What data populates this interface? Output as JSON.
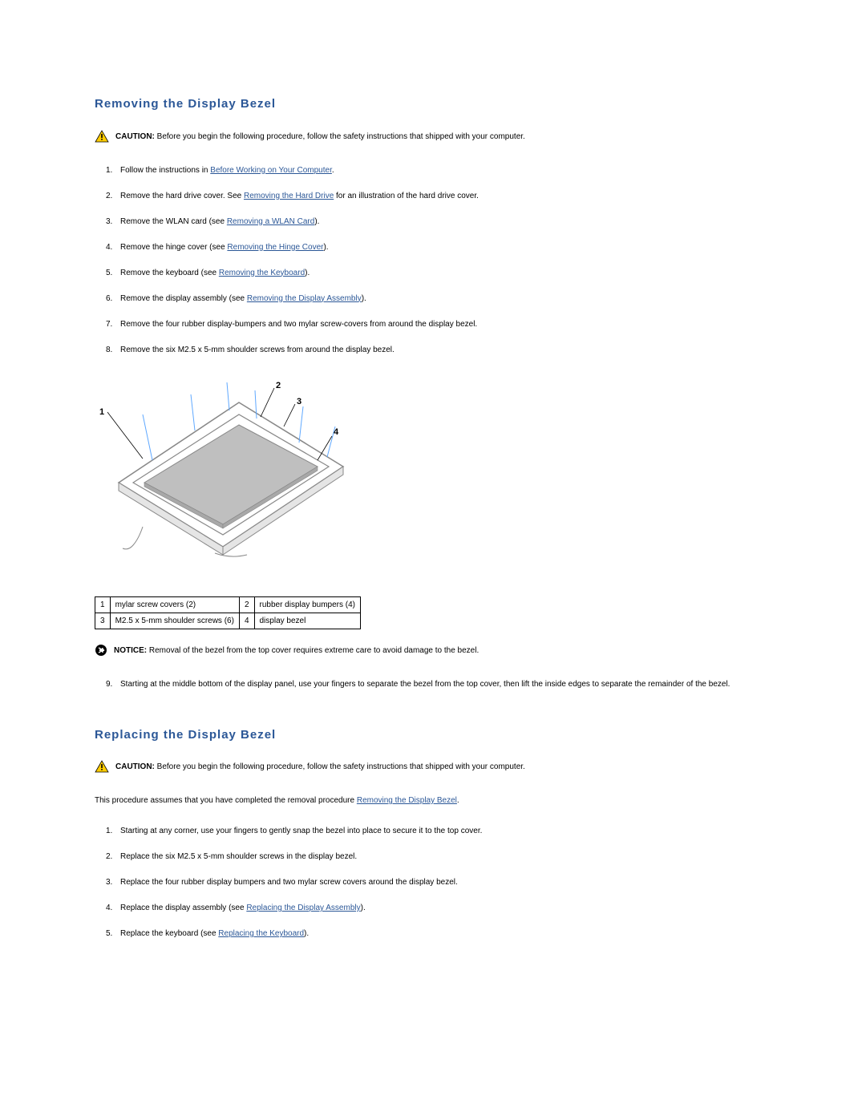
{
  "section1": {
    "heading": "Removing the Display Bezel",
    "caution_label": "CAUTION:",
    "caution_text": "Before you begin the following procedure, follow the safety instructions that shipped with your computer.",
    "steps": [
      {
        "num": "1.",
        "pre": "Follow the instructions in ",
        "link": "Before Working on Your Computer",
        "post": "."
      },
      {
        "num": "2.",
        "pre": "Remove the hard drive cover. See ",
        "link": "Removing the Hard Drive",
        "post": " for an illustration of the hard drive cover."
      },
      {
        "num": "3.",
        "pre": "Remove the WLAN card (see ",
        "link": "Removing a WLAN Card",
        "post": ")."
      },
      {
        "num": "4.",
        "pre": "Remove the hinge cover (see ",
        "link": "Removing the Hinge Cover",
        "post": ")."
      },
      {
        "num": "5.",
        "pre": "Remove the keyboard (see ",
        "link": "Removing the Keyboard",
        "post": ")."
      },
      {
        "num": "6.",
        "pre": "Remove the display assembly (see ",
        "link": "Removing the Display Assembly",
        "post": ")."
      },
      {
        "num": "7.",
        "pre": "Remove the four rubber display-bumpers and two mylar screw-covers from around the display bezel.",
        "link": "",
        "post": ""
      },
      {
        "num": "8.",
        "pre": "Remove the six M2.5 x 5-mm shoulder screws from around the display bezel.",
        "link": "",
        "post": ""
      }
    ],
    "legend": {
      "r1c1": "1",
      "r1c2": "mylar screw covers (2)",
      "r1c3": "2",
      "r1c4": "rubber display bumpers (4)",
      "r2c1": "3",
      "r2c2": "M2.5 x 5-mm shoulder screws (6)",
      "r2c3": "4",
      "r2c4": "display bezel"
    },
    "callouts": {
      "c1": "1",
      "c2": "2",
      "c3": "3",
      "c4": "4"
    },
    "notice_label": "NOTICE:",
    "notice_text": "Removal of the bezel from the top cover requires extreme care to avoid damage to the bezel.",
    "step9": {
      "num": "9.",
      "text": "Starting at the middle bottom of the display panel, use your fingers to separate the bezel from the top cover, then lift the inside edges to separate the remainder of the bezel."
    }
  },
  "section2": {
    "heading": "Replacing the Display Bezel",
    "caution_label": "CAUTION:",
    "caution_text": "Before you begin the following procedure, follow the safety instructions that shipped with your computer.",
    "intro_pre": "This procedure assumes that you have completed the removal procedure ",
    "intro_link": "Removing the Display Bezel",
    "intro_post": ".",
    "steps": [
      {
        "num": "1.",
        "pre": "Starting at any corner, use your fingers to gently snap the bezel into place to secure it to the top cover.",
        "link": "",
        "post": ""
      },
      {
        "num": "2.",
        "pre": "Replace the six M2.5 x 5-mm shoulder screws in the display bezel.",
        "link": "",
        "post": ""
      },
      {
        "num": "3.",
        "pre": "Replace the four rubber display bumpers and two mylar screw covers around the display bezel.",
        "link": "",
        "post": ""
      },
      {
        "num": "4.",
        "pre": "Replace the display assembly (see ",
        "link": "Replacing the Display Assembly",
        "post": ")."
      },
      {
        "num": "5.",
        "pre": "Replace the keyboard (see ",
        "link": "Replacing the Keyboard",
        "post": ")."
      }
    ]
  }
}
